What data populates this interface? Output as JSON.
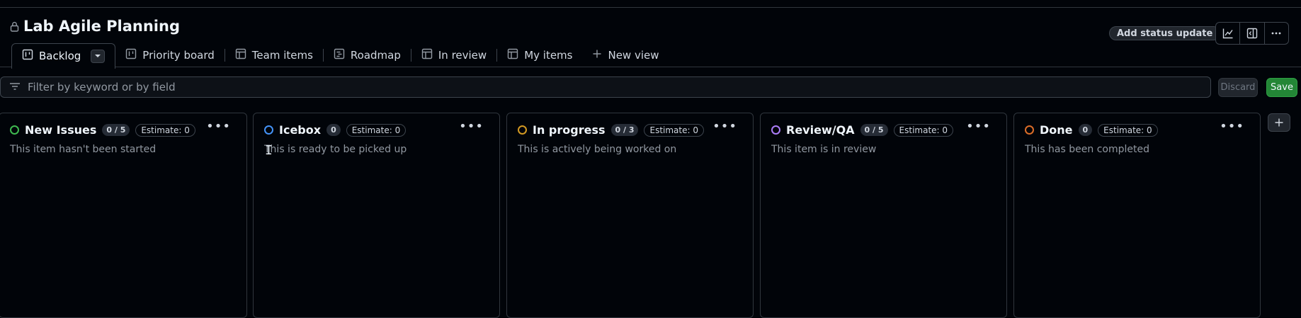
{
  "project": {
    "title": "Lab Agile Planning"
  },
  "header": {
    "status_update_label": "Add status update",
    "icons": [
      "insights-icon",
      "side-panel-icon",
      "more-options-icon"
    ]
  },
  "views": {
    "tabs": [
      {
        "label": "Backlog",
        "icon": "board-icon",
        "active": true
      },
      {
        "label": "Priority board",
        "icon": "board-icon"
      },
      {
        "label": "Team items",
        "icon": "table-icon"
      },
      {
        "label": "Roadmap",
        "icon": "roadmap-icon"
      },
      {
        "label": "In review",
        "icon": "table-icon"
      },
      {
        "label": "My items",
        "icon": "table-icon"
      }
    ],
    "new_view_label": "New view"
  },
  "filter": {
    "placeholder": "Filter by keyword or by field",
    "discard_label": "Discard",
    "save_label": "Save"
  },
  "columns": [
    {
      "name": "New Issues",
      "count": "0 / 5",
      "estimate": "Estimate: 0",
      "description": "This item hasn't been started",
      "color": "#3fb950"
    },
    {
      "name": "Icebox",
      "count": "0",
      "estimate": "Estimate: 0",
      "description": "This is ready to be picked up",
      "color": "#4493f8"
    },
    {
      "name": "In progress",
      "count": "0 / 3",
      "estimate": "Estimate: 0",
      "description": "This is actively being worked on",
      "color": "#d29922"
    },
    {
      "name": "Review/QA",
      "count": "0 / 5",
      "estimate": "Estimate: 0",
      "description": "This item is in review",
      "color": "#ab7df8"
    },
    {
      "name": "Done",
      "count": "0",
      "estimate": "Estimate: 0",
      "description": "This has been completed",
      "color": "#db6d28"
    }
  ],
  "colors": {
    "accent_save": "#238636",
    "background": "#010409"
  }
}
